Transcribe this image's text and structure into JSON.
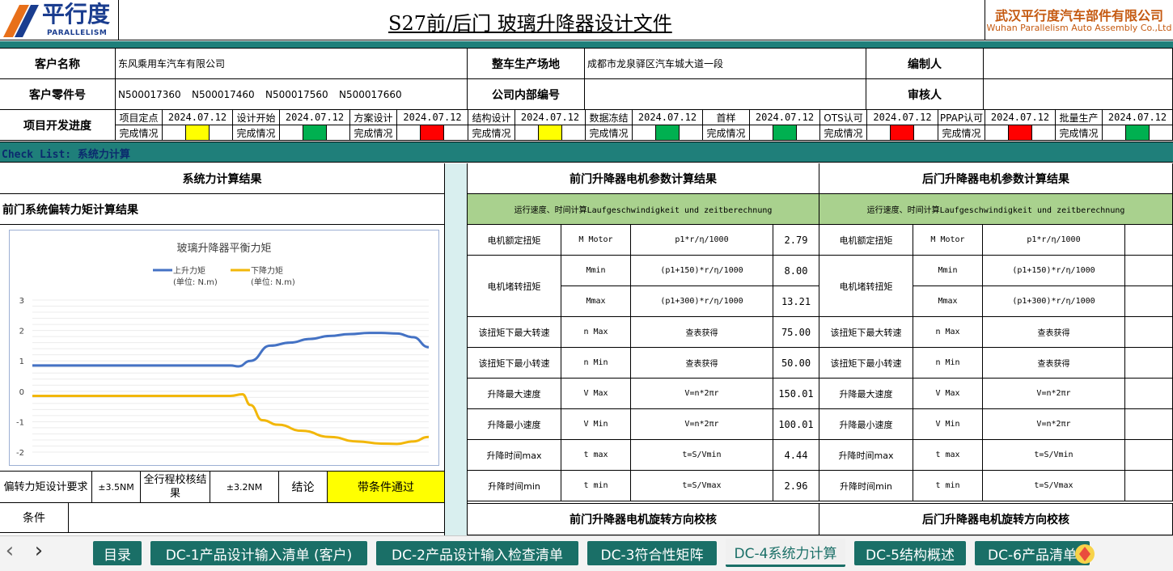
{
  "header": {
    "logo_text": "平行度",
    "logo_sub": "PARALLELISM",
    "doc_title": "S27前/后门 玻璃升降器设计文件",
    "company_cn": "武汉平行度汽车部件有限公司",
    "company_en": "Wuhan Parallelism Auto Assembly Co.,Ltd"
  },
  "info": {
    "customer_label": "客户名称",
    "customer_value": "东风乘用车汽车有限公司",
    "site_label": "整车生产场地",
    "site_value": "成都市龙泉驿区汽车城大道一段",
    "editor_label": "编制人",
    "editor_value": "",
    "part_label": "客户零件号",
    "part_values": [
      "N500017360",
      "N500017460",
      "N500017560",
      "N500017660"
    ],
    "internal_label": "公司内部编号",
    "internal_value": "",
    "reviewer_label": "审核人",
    "reviewer_value": ""
  },
  "progress": {
    "label": "项目开发进度",
    "status_label": "完成情况",
    "milestones": [
      {
        "name": "项目定点",
        "date": "2024.07.12",
        "status": "#ffff00"
      },
      {
        "name": "设计开始",
        "date": "2024.07.12",
        "status": "#00b050"
      },
      {
        "name": "方案设计",
        "date": "2024.07.12",
        "status": "#ff0000"
      },
      {
        "name": "结构设计",
        "date": "2024.07.12",
        "status": "#ffff00"
      },
      {
        "name": "数据冻结",
        "date": "2024.07.12",
        "status": "#00b050"
      },
      {
        "name": "首样",
        "date": "2024.07.12",
        "status": "#00b050"
      },
      {
        "name": "OTS认可",
        "date": "2024.07.12",
        "status": "#ff0000"
      },
      {
        "name": "PPAP认可",
        "date": "2024.07.12",
        "status": "#ff0000"
      },
      {
        "name": "批量生产",
        "date": "2024.07.12",
        "status": "#00b050"
      }
    ]
  },
  "checklist_title": "Check List: 系统力计算",
  "left_panel": {
    "title": "系统力计算结果",
    "subtitle": "前门系统偏转力矩计算结果",
    "req_label": "偏转力矩设计要求",
    "req_value": "±3.5NM",
    "check_label": "全行程校核结果",
    "check_value": "±3.2NM",
    "conclusion_label": "结论",
    "conclusion_value": "带条件通过",
    "condition_label": "条件",
    "condition_value": ""
  },
  "chart_data": {
    "type": "line",
    "title": "玻璃升降器平衡力矩",
    "ylim": [
      -2,
      3
    ],
    "yticks": [
      "3",
      "2",
      "1",
      "0",
      "-1",
      "-2"
    ],
    "legend_placement": "top",
    "series": [
      {
        "name": "上升力矩",
        "unit": "(单位: N.m)",
        "color": "#4472c4",
        "x": [
          0,
          10,
          20,
          30,
          40,
          50,
          52,
          55,
          60,
          65,
          70,
          75,
          80,
          85,
          88,
          92,
          96,
          100
        ],
        "values": [
          0.85,
          0.85,
          0.85,
          0.85,
          0.85,
          0.85,
          0.82,
          1.0,
          1.5,
          1.6,
          1.72,
          1.82,
          1.88,
          1.92,
          1.92,
          1.9,
          1.78,
          1.45
        ]
      },
      {
        "name": "下降力矩",
        "unit": "(单位: N.m)",
        "color": "#f2b70a",
        "x": [
          0,
          10,
          20,
          30,
          40,
          50,
          53,
          55,
          58,
          62,
          68,
          75,
          82,
          88,
          92,
          96,
          100
        ],
        "values": [
          -0.15,
          -0.15,
          -0.15,
          -0.15,
          -0.15,
          -0.15,
          -0.1,
          -0.45,
          -0.95,
          -1.1,
          -1.3,
          -1.5,
          -1.65,
          -1.72,
          -1.73,
          -1.65,
          -1.5
        ]
      }
    ]
  },
  "front_motor": {
    "title": "前门升降器电机参数计算结果",
    "band": "运行速度、时间计算Laufgeschwindigkeit und zeitberechnung",
    "rows": [
      {
        "name": "电机额定扭矩",
        "sym": "M Motor",
        "formula": "p1*r/η/1000",
        "value": "2.79"
      },
      {
        "name": "电机堵转扭矩",
        "sym": "Mmin",
        "formula": "(p1+150)*r/η/1000",
        "value": "8.00"
      },
      {
        "name": "",
        "sym": "Mmax",
        "formula": "(p1+300)*r/η/1000",
        "value": "13.21"
      },
      {
        "name": "该扭矩下最大转速",
        "sym": "n Max",
        "formula": "查表获得",
        "value": "75.00"
      },
      {
        "name": "该扭矩下最小转速",
        "sym": "n Min",
        "formula": "查表获得",
        "value": "50.00"
      },
      {
        "name": "升降最大速度",
        "sym": "V Max",
        "formula": "V=n*2πr",
        "value": "150.01"
      },
      {
        "name": "升降最小速度",
        "sym": "V Min",
        "formula": "V=n*2πr",
        "value": "100.01"
      },
      {
        "name": "升降时间max",
        "sym": "t max",
        "formula": "t=S/Vmin",
        "value": "4.44"
      },
      {
        "name": "升降时间min",
        "sym": "t min",
        "formula": "t=S/Vmax",
        "value": "2.96"
      }
    ],
    "rotation_title": "前门升降器电机旋转方向校核"
  },
  "rear_motor": {
    "title": "后门升降器电机参数计算结果",
    "band": "运行速度、时间计算Laufgeschwindigkeit und zeitberechnung",
    "rows": [
      {
        "name": "电机额定扭矩",
        "sym": "M Motor",
        "formula": "p1*r/η/1000",
        "value": ""
      },
      {
        "name": "电机堵转扭矩",
        "sym": "Mmin",
        "formula": "(p1+150)*r/η/1000",
        "value": ""
      },
      {
        "name": "",
        "sym": "Mmax",
        "formula": "(p1+300)*r/η/1000",
        "value": ""
      },
      {
        "name": "该扭矩下最大转速",
        "sym": "n Max",
        "formula": "查表获得",
        "value": ""
      },
      {
        "name": "该扭矩下最小转速",
        "sym": "n Min",
        "formula": "查表获得",
        "value": ""
      },
      {
        "name": "升降最大速度",
        "sym": "V Max",
        "formula": "V=n*2πr",
        "value": ""
      },
      {
        "name": "升降最小速度",
        "sym": "V Min",
        "formula": "V=n*2πr",
        "value": ""
      },
      {
        "name": "升降时间max",
        "sym": "t max",
        "formula": "t=S/Vmin",
        "value": ""
      },
      {
        "name": "升降时间min",
        "sym": "t min",
        "formula": "t=S/Vmax",
        "value": ""
      }
    ],
    "rotation_title": "后门升降器电机旋转方向校核"
  },
  "tabs": [
    {
      "label": "目录",
      "active": false
    },
    {
      "label": "DC-1产品设计输入清单 (客户)",
      "active": false
    },
    {
      "label": "DC-2产品设计输入检查清单",
      "active": false
    },
    {
      "label": "DC-3符合性矩阵",
      "active": false
    },
    {
      "label": "DC-4系统力计算",
      "active": true
    },
    {
      "label": "DC-5结构概述",
      "active": false
    },
    {
      "label": "DC-6产品清单",
      "active": false
    }
  ],
  "nav": {
    "prev": "‹",
    "next": "›"
  }
}
